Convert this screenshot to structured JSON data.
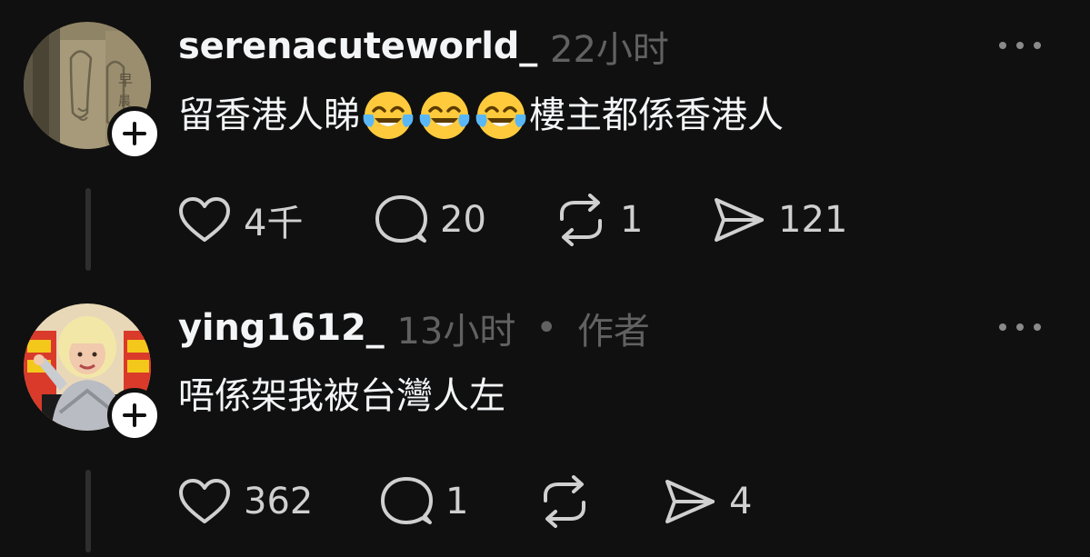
{
  "colors": {
    "background": "#101010",
    "primary_text": "#f3f5f7",
    "secondary_text": "#616161",
    "icon": "#d0d0d0",
    "thread_line": "#2e2e2e"
  },
  "comments": [
    {
      "username": "serenacuteworld_",
      "time": "22小时",
      "author_tag": "",
      "text_before": "留香港人睇",
      "emojis": [
        "face-with-tears-of-joy",
        "face-with-tears-of-joy",
        "face-with-tears-of-joy"
      ],
      "text_after": "樓主都係香港人",
      "stats": {
        "likes": "4千",
        "replies": "20",
        "reposts": "1",
        "shares": "121"
      }
    },
    {
      "username": "ying1612_",
      "time": "13小时",
      "dot": "•",
      "author_tag": "作者",
      "text_before": "唔係架我被台灣人左",
      "emojis": [],
      "text_after": "",
      "stats": {
        "likes": "362",
        "replies": "1",
        "reposts": "",
        "shares": "4"
      }
    }
  ]
}
